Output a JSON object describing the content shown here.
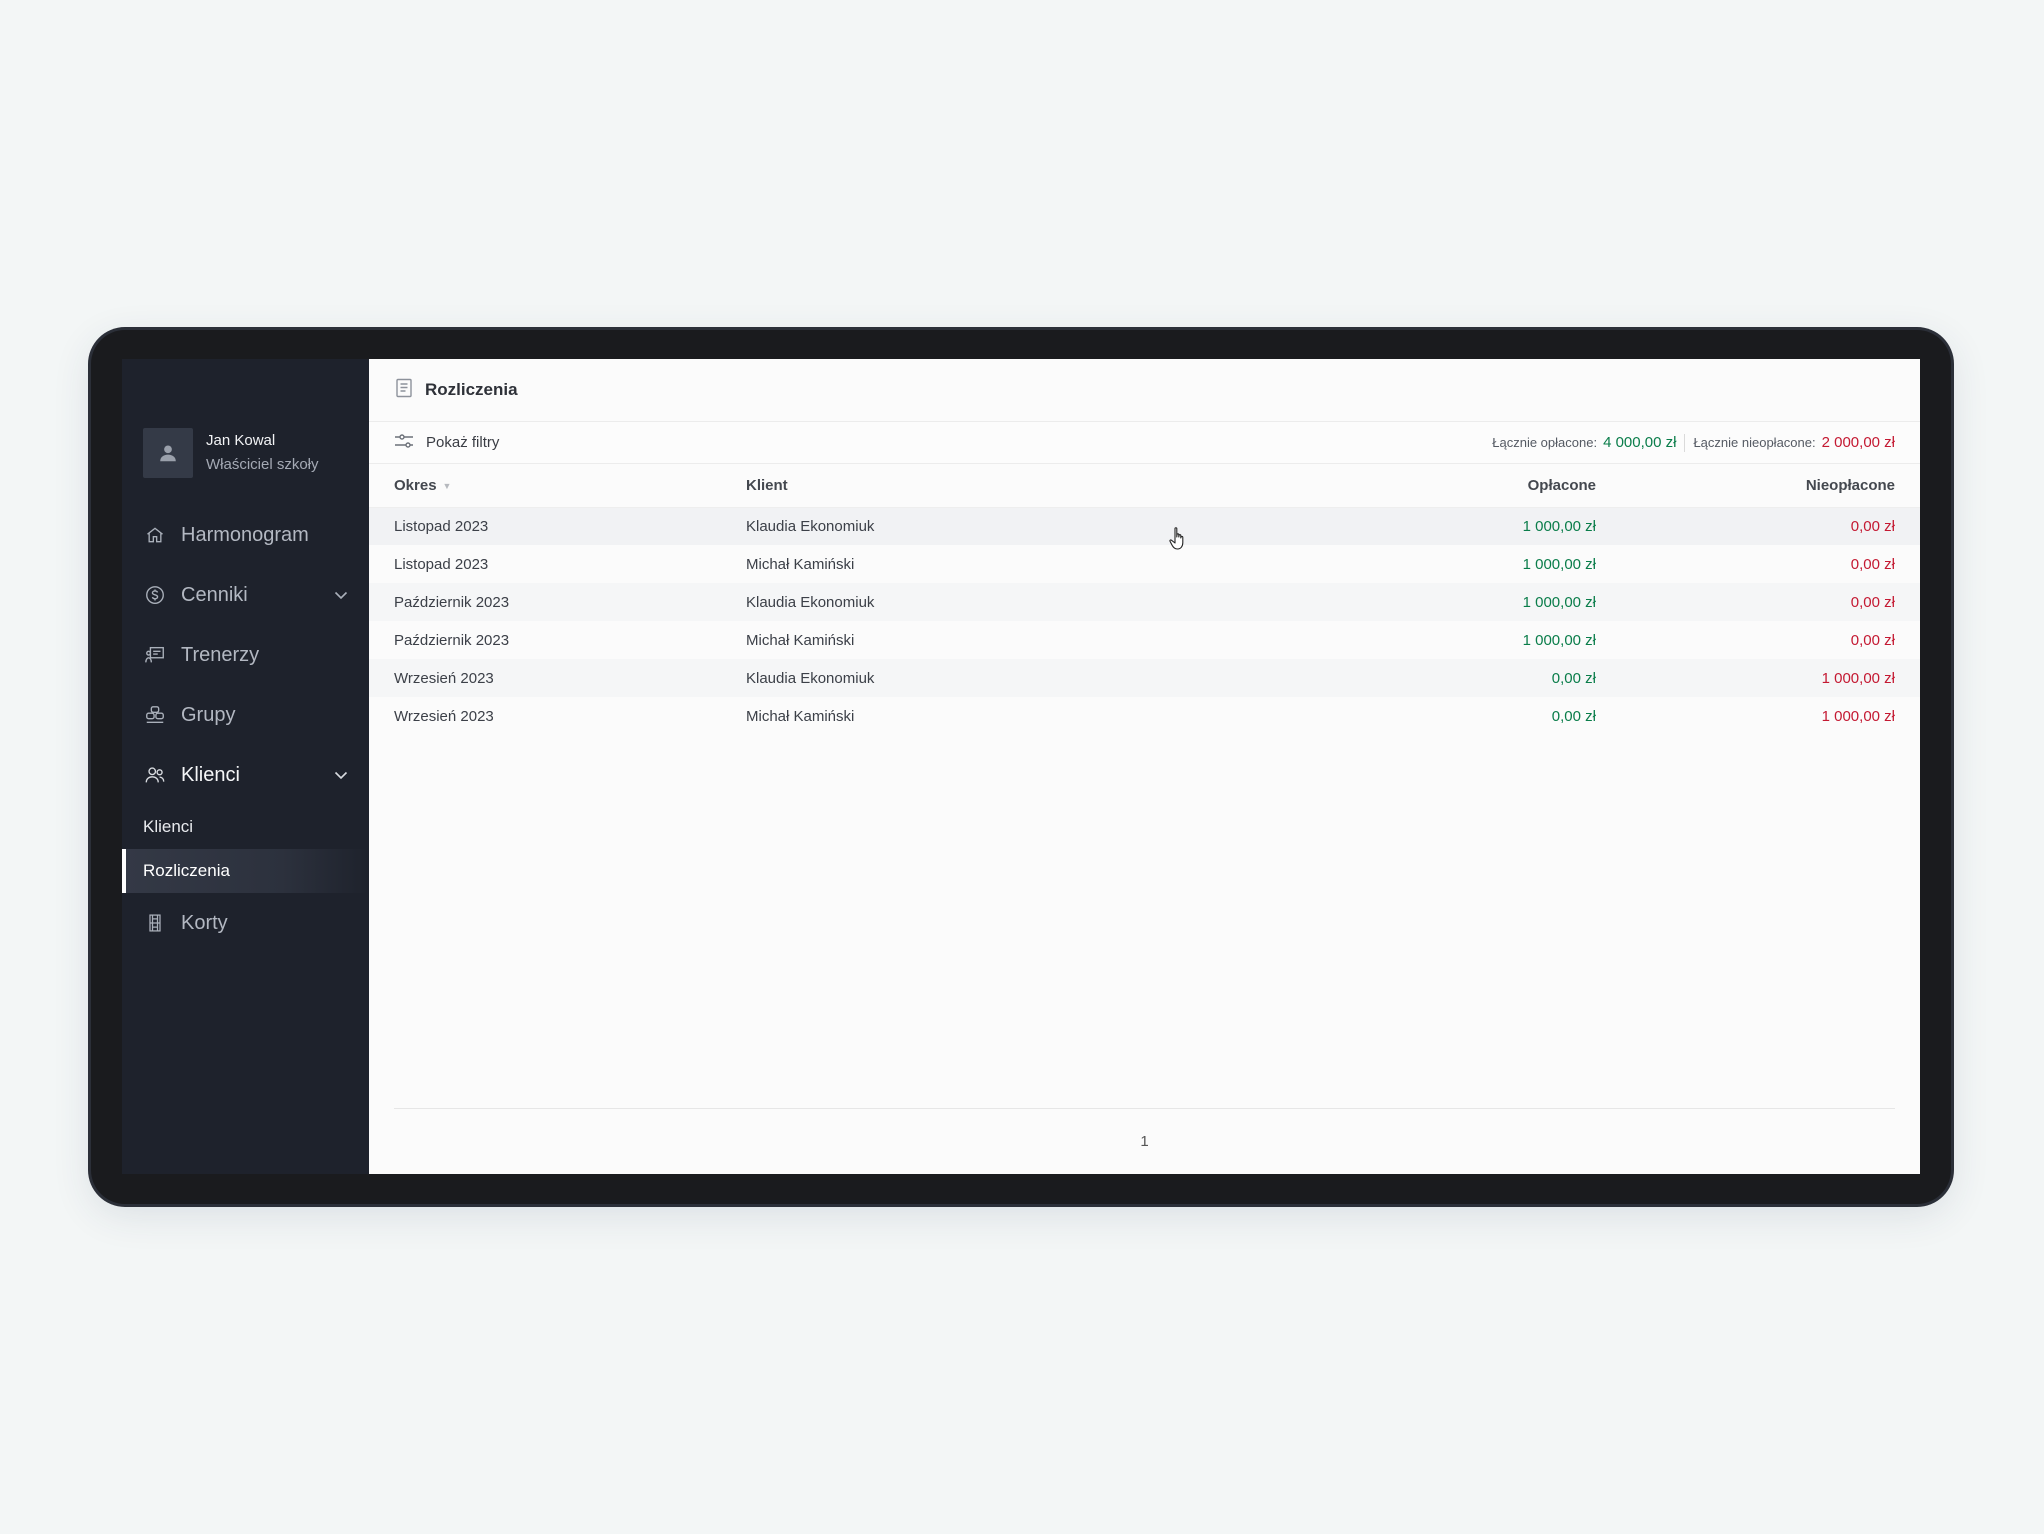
{
  "profile": {
    "name": "Jan Kowal",
    "role": "Właściciel szkoły",
    "avatar_icon": "user-icon"
  },
  "sidebar": {
    "items": [
      {
        "label": "Harmonogram",
        "icon": "home-icon"
      },
      {
        "label": "Cenniki",
        "icon": "dollar-circle-icon",
        "expandable": true
      },
      {
        "label": "Trenerzy",
        "icon": "trainer-board-icon"
      },
      {
        "label": "Grupy",
        "icon": "group-icon"
      },
      {
        "label": "Klienci",
        "icon": "users-icon",
        "expandable": true,
        "expanded": true,
        "active": true
      },
      {
        "label": "Korty",
        "icon": "court-icon"
      }
    ],
    "subitems": [
      {
        "label": "Klienci"
      },
      {
        "label": "Rozliczenia",
        "active": true
      }
    ]
  },
  "header": {
    "title": "Rozliczenia",
    "icon": "document-icon"
  },
  "toolbar": {
    "filters_label": "Pokaż filtry",
    "filters_icon": "sliders-icon",
    "total_paid_label": "Łącznie opłacone:",
    "total_paid_value": "4 000,00 zł",
    "total_unpaid_label": "Łącznie nieopłacone:",
    "total_unpaid_value": "2 000,00 zł"
  },
  "table": {
    "columns": [
      "Okres",
      "Klient",
      "Opłacone",
      "Nieopłacone"
    ],
    "rows": [
      [
        "Listopad 2023",
        "Klaudia Ekonomiuk",
        "1 000,00 zł",
        "0,00 zł"
      ],
      [
        "Listopad 2023",
        "Michał Kamiński",
        "1 000,00 zł",
        "0,00 zł"
      ],
      [
        "Październik 2023",
        "Klaudia Ekonomiuk",
        "1 000,00 zł",
        "0,00 zł"
      ],
      [
        "Październik 2023",
        "Michał Kamiński",
        "1 000,00 zł",
        "0,00 zł"
      ],
      [
        "Wrzesień 2023",
        "Klaudia Ekonomiuk",
        "0,00 zł",
        "1 000,00 zł"
      ],
      [
        "Wrzesień 2023",
        "Michał Kamiński",
        "0,00 zł",
        "1 000,00 zł"
      ]
    ]
  },
  "pagination": {
    "current_page": "1"
  },
  "colors": {
    "paid": "#0a7d4a",
    "unpaid": "#c41932",
    "sidebar_bg": "#1e222c"
  }
}
